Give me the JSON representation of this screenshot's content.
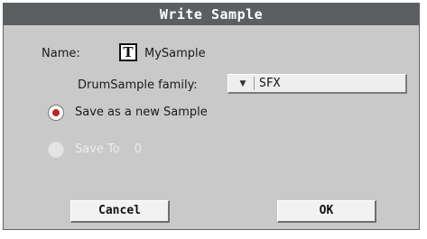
{
  "dialog": {
    "title": "Write Sample",
    "name_label": "Name:",
    "text_button_glyph": "T",
    "name_value": "MySample",
    "family_label": "DrumSample family:",
    "family_value": "SFX",
    "family_arrow": "▼",
    "radio_new_label": "Save as a new Sample",
    "radio_saveto_label": "Save To",
    "radio_saveto_value": "0",
    "cancel_label": "Cancel",
    "ok_label": "OK"
  },
  "colors": {
    "titlebar": "#5b5f62",
    "dialog_bg": "#c9c9c9",
    "radio_selected": "#b3282d"
  }
}
